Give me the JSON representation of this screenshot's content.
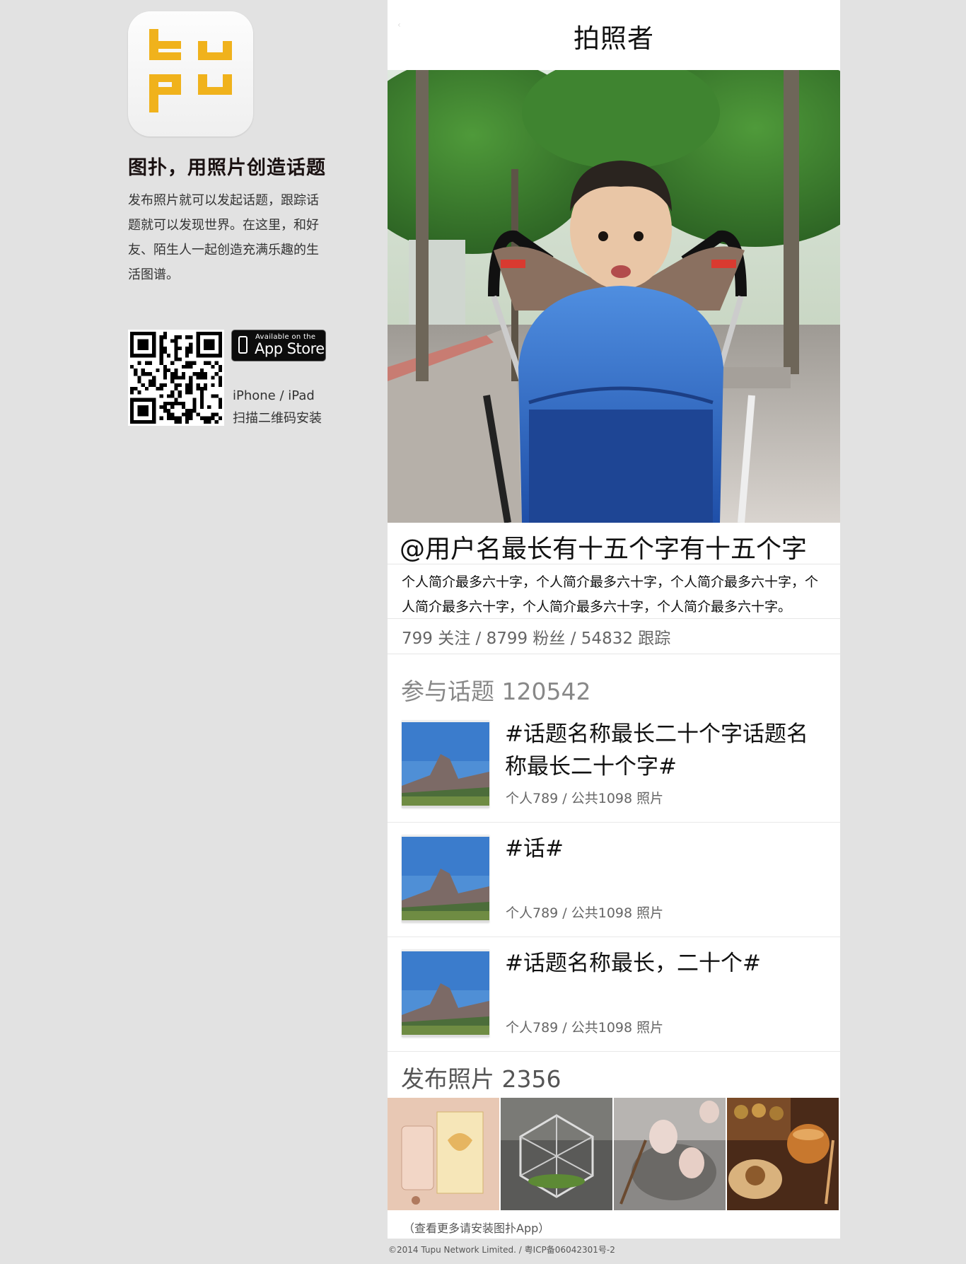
{
  "promo": {
    "logo_alt": "tupu",
    "title": "图扑，用照片创造话题",
    "description": "发布照片就可以发起话题，跟踪话题就可以发现世界。在这里，和好友、陌生人一起创造充满乐趣的生活图谱。",
    "appstore_small": "Available on the",
    "appstore_big": "App Store",
    "device_line": "iPhone / iPad",
    "scan_line": "扫描二维码安装"
  },
  "header": {
    "title": "拍照者"
  },
  "profile": {
    "username": "@用户名最长有十五个字有十五个字",
    "bio": "个人简介最多六十字，个人简介最多六十字，个人简介最多六十字，个人简介最多六十字，个人简介最多六十字，个人简介最多六十字。",
    "stats": "799 关注 / 8799 粉丝 / 54832 跟踪"
  },
  "topics": {
    "heading": "参与话题 120542",
    "items": [
      {
        "name": "#话题名称最长二十个字话题名称最长二十个字#",
        "count": "个人789 / 公共1098 照片"
      },
      {
        "name": "#话#",
        "count": "个人789 / 公共1098 照片"
      },
      {
        "name": "#话题名称最长，二十个#",
        "count": "个人789 / 公共1098 照片"
      }
    ]
  },
  "photos": {
    "heading": "发布照片 2356",
    "more_note": "（查看更多请安装图扑App）"
  },
  "footer": {
    "copyright": "©2014 Tupu Network Limited. / 粤ICP备06042301号-2"
  },
  "colors": {
    "logo_yellow": "#f0b21c",
    "page_bg": "#e2e2e2",
    "panel_bg": "#ffffff"
  }
}
